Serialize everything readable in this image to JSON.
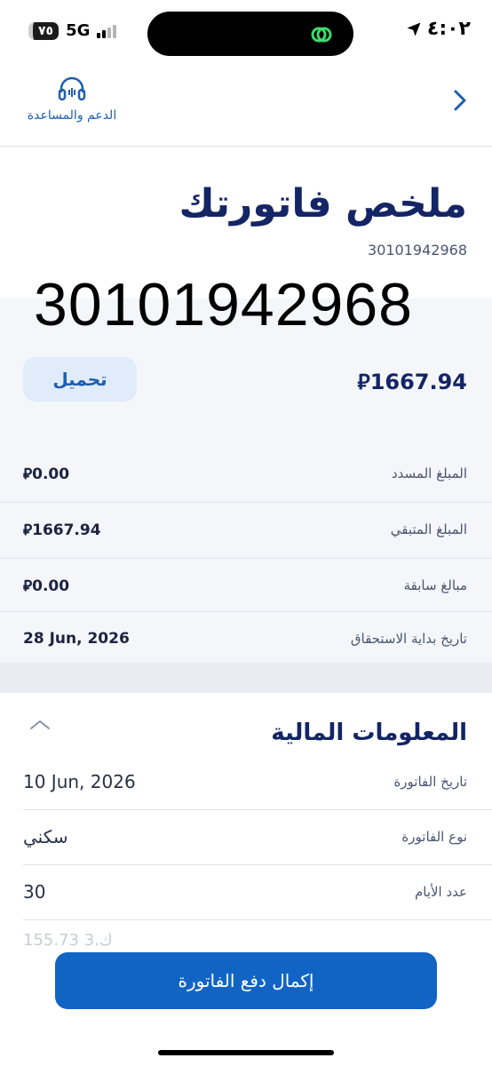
{
  "status": {
    "time": "٤:٠٢",
    "battery": "٧٥",
    "network": "5G"
  },
  "header": {
    "support_label": "الدعم والمساعدة"
  },
  "summary": {
    "title": "ملخص فاتورتك",
    "account_number_small": "30101942968",
    "account_number_large": "30101942968",
    "total": "1667.94",
    "download_label": "تحميل",
    "currency_symbol": "⃁"
  },
  "details": [
    {
      "label": "المبلغ المسدد",
      "value": "0.00"
    },
    {
      "label": "المبلغ المتبقي",
      "value": "1667.94"
    },
    {
      "label": "مبالغ سابقة",
      "value": "0.00"
    },
    {
      "label": "تاريخ بداية الاستحقاق",
      "value": "28 Jun, 2026"
    }
  ],
  "financial": {
    "title": "المعلومات المالية",
    "rows": [
      {
        "label": "تاريخ الفاتورة",
        "value": "10 Jun, 2026"
      },
      {
        "label": "نوع الفاتورة",
        "value": "سكني"
      },
      {
        "label": "عدد الأيام",
        "value": "30"
      }
    ],
    "faded": "ك.3 155.73"
  },
  "footer": {
    "pay_label": "إكمال دفع الفاتورة"
  },
  "colors": {
    "primary": "#1264c4",
    "title": "#142566",
    "panel": "#f4f6f9"
  }
}
